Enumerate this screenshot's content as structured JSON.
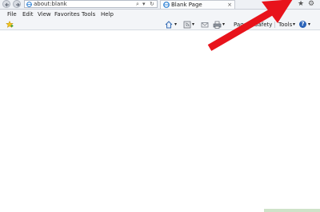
{
  "address_bar": {
    "url": "about:blank",
    "search_glyph": "⌕",
    "dropdown_glyph": "▾",
    "refresh_glyph": "↻"
  },
  "tab": {
    "title": "Blank Page",
    "close_glyph": "×"
  },
  "window_icons": {
    "favorites_star": "★",
    "settings_gear": "⚙"
  },
  "menubar": {
    "items": [
      "File",
      "Edit",
      "View",
      "Favorites",
      "Tools",
      "Help"
    ]
  },
  "command_bar": {
    "page_label": "Page",
    "safety_label": "Safety",
    "tools_label": "Tools",
    "help_glyph": "?"
  },
  "colors": {
    "annotation_arrow": "#e8131b",
    "ie_blue": "#2a7fd4"
  }
}
